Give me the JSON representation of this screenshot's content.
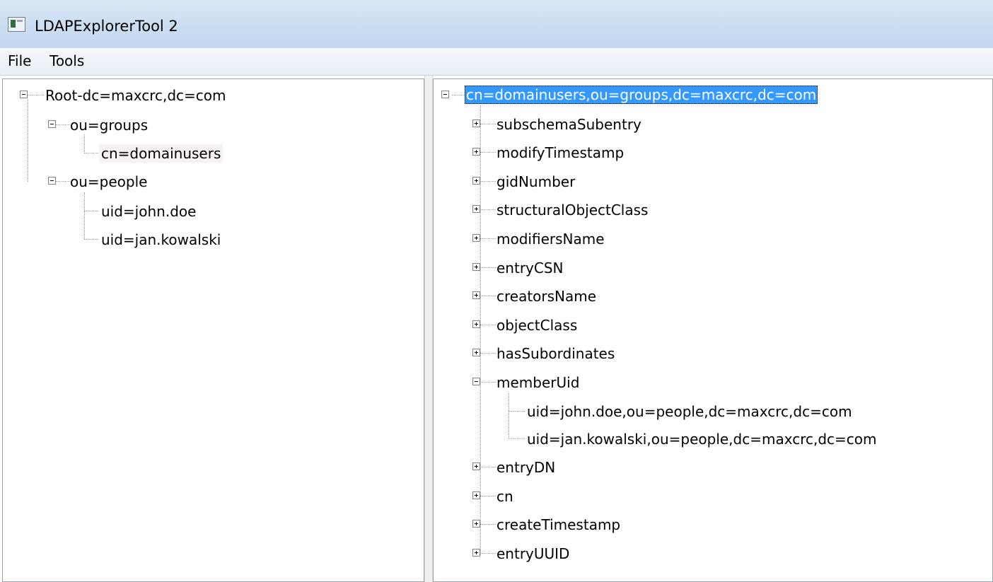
{
  "window": {
    "title": "LDAPExplorerTool 2"
  },
  "menu": {
    "file": "File",
    "tools": "Tools"
  },
  "left_tree": {
    "root": "Root-dc=maxcrc,dc=com",
    "groups": "ou=groups",
    "domainusers": "cn=domainusers",
    "people": "ou=people",
    "john": "uid=john.doe",
    "jan": "uid=jan.kowalski"
  },
  "right_tree": {
    "entry": "cn=domainusers,ou=groups,dc=maxcrc,dc=com",
    "attributes": [
      "subschemaSubentry",
      "modifyTimestamp",
      "gidNumber",
      "structuralObjectClass",
      "modifiersName",
      "entryCSN",
      "creatorsName",
      "objectClass",
      "hasSubordinates",
      "memberUid",
      "entryDN",
      "cn",
      "createTimestamp",
      "entryUUID"
    ],
    "member_values": [
      "uid=john.doe,ou=people,dc=maxcrc,dc=com",
      "uid=jan.kowalski,ou=people,dc=maxcrc,dc=com"
    ]
  }
}
